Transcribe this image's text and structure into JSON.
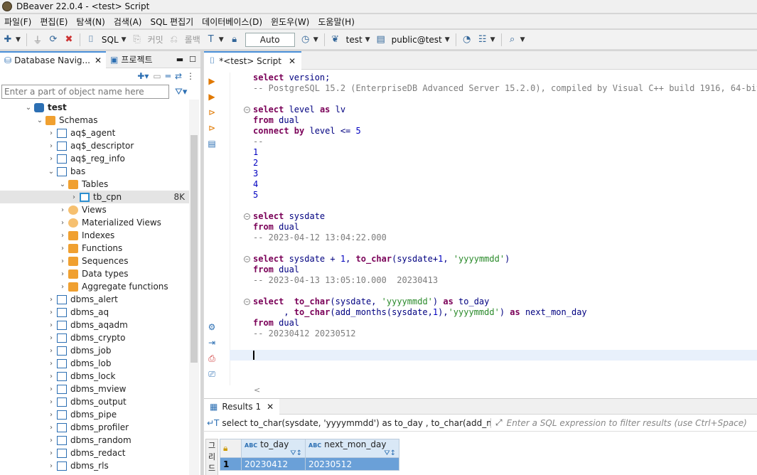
{
  "window": {
    "title": "DBeaver 22.0.4 - <test> Script"
  },
  "menubar": {
    "items": [
      "파일(F)",
      "편집(E)",
      "탐색(N)",
      "검색(A)",
      "SQL 편집기",
      "데이터베이스(D)",
      "윈도우(W)",
      "도움말(H)"
    ]
  },
  "toolbar": {
    "sql_label": "SQL",
    "commit_label": "커밋",
    "rollback_label": "롤백",
    "transaction_mode": "Auto",
    "connection": "test",
    "schema": "public@test"
  },
  "navigator": {
    "tab_label": "Database Navig...",
    "project_tab_label": "프로젝트",
    "filter_placeholder": "Enter a part of object name here",
    "tree": [
      {
        "label": "test",
        "level": 0,
        "arrow": "v",
        "icon": "db",
        "bold": true
      },
      {
        "label": "Schemas",
        "level": 1,
        "arrow": "v",
        "icon": "folder"
      },
      {
        "label": "aq$_agent",
        "level": 2,
        "arrow": ">",
        "icon": "schema"
      },
      {
        "label": "aq$_descriptor",
        "level": 2,
        "arrow": ">",
        "icon": "schema"
      },
      {
        "label": "aq$_reg_info",
        "level": 2,
        "arrow": ">",
        "icon": "schema"
      },
      {
        "label": "bas",
        "level": 2,
        "arrow": "v",
        "icon": "schema"
      },
      {
        "label": "Tables",
        "level": 3,
        "arrow": "v",
        "icon": "folder"
      },
      {
        "label": "tb_cpn",
        "level": 4,
        "arrow": ">",
        "icon": "table",
        "extra": "8K",
        "selected": true
      },
      {
        "label": "Views",
        "level": 3,
        "arrow": ">",
        "icon": "view"
      },
      {
        "label": "Materialized Views",
        "level": 3,
        "arrow": ">",
        "icon": "view"
      },
      {
        "label": "Indexes",
        "level": 3,
        "arrow": ">",
        "icon": "folder"
      },
      {
        "label": "Functions",
        "level": 3,
        "arrow": ">",
        "icon": "folder"
      },
      {
        "label": "Sequences",
        "level": 3,
        "arrow": ">",
        "icon": "folder"
      },
      {
        "label": "Data types",
        "level": 3,
        "arrow": ">",
        "icon": "folder"
      },
      {
        "label": "Aggregate functions",
        "level": 3,
        "arrow": ">",
        "icon": "folder"
      },
      {
        "label": "dbms_alert",
        "level": 2,
        "arrow": ">",
        "icon": "schema"
      },
      {
        "label": "dbms_aq",
        "level": 2,
        "arrow": ">",
        "icon": "schema"
      },
      {
        "label": "dbms_aqadm",
        "level": 2,
        "arrow": ">",
        "icon": "schema"
      },
      {
        "label": "dbms_crypto",
        "level": 2,
        "arrow": ">",
        "icon": "schema"
      },
      {
        "label": "dbms_job",
        "level": 2,
        "arrow": ">",
        "icon": "schema"
      },
      {
        "label": "dbms_lob",
        "level": 2,
        "arrow": ">",
        "icon": "schema"
      },
      {
        "label": "dbms_lock",
        "level": 2,
        "arrow": ">",
        "icon": "schema"
      },
      {
        "label": "dbms_mview",
        "level": 2,
        "arrow": ">",
        "icon": "schema"
      },
      {
        "label": "dbms_output",
        "level": 2,
        "arrow": ">",
        "icon": "schema"
      },
      {
        "label": "dbms_pipe",
        "level": 2,
        "arrow": ">",
        "icon": "schema"
      },
      {
        "label": "dbms_profiler",
        "level": 2,
        "arrow": ">",
        "icon": "schema"
      },
      {
        "label": "dbms_random",
        "level": 2,
        "arrow": ">",
        "icon": "schema"
      },
      {
        "label": "dbms_redact",
        "level": 2,
        "arrow": ">",
        "icon": "schema"
      },
      {
        "label": "dbms_rls",
        "level": 2,
        "arrow": ">",
        "icon": "schema"
      }
    ]
  },
  "editor": {
    "tab_label": "*<test> Script",
    "lines": [
      {
        "fold": false,
        "tokens": [
          [
            "kw",
            "select"
          ],
          [
            "fn",
            " version;"
          ]
        ]
      },
      {
        "fold": false,
        "tokens": [
          [
            "cmt",
            "-- PostgreSQL 15.2 (EnterpriseDB Advanced Server 15.2.0), compiled by Visual C++ build 1916, 64-bit"
          ]
        ]
      },
      {
        "fold": false,
        "tokens": []
      },
      {
        "fold": true,
        "tokens": [
          [
            "kw",
            "select"
          ],
          [
            "fn",
            " level "
          ],
          [
            "kw",
            "as"
          ],
          [
            "fn",
            " lv"
          ]
        ]
      },
      {
        "fold": false,
        "tokens": [
          [
            "kw",
            "from"
          ],
          [
            "fn",
            " dual"
          ]
        ]
      },
      {
        "fold": false,
        "tokens": [
          [
            "kw",
            "connect by"
          ],
          [
            "fn",
            " level <= "
          ],
          [
            "num",
            "5"
          ]
        ]
      },
      {
        "fold": false,
        "tokens": [
          [
            "cmt",
            "--"
          ]
        ]
      },
      {
        "fold": false,
        "tokens": [
          [
            "num",
            "1"
          ]
        ]
      },
      {
        "fold": false,
        "tokens": [
          [
            "num",
            "2"
          ]
        ]
      },
      {
        "fold": false,
        "tokens": [
          [
            "num",
            "3"
          ]
        ]
      },
      {
        "fold": false,
        "tokens": [
          [
            "num",
            "4"
          ]
        ]
      },
      {
        "fold": false,
        "tokens": [
          [
            "num",
            "5"
          ]
        ]
      },
      {
        "fold": false,
        "tokens": []
      },
      {
        "fold": true,
        "tokens": [
          [
            "kw",
            "select"
          ],
          [
            "fn",
            " sysdate"
          ]
        ]
      },
      {
        "fold": false,
        "tokens": [
          [
            "kw",
            "from"
          ],
          [
            "fn",
            " dual"
          ]
        ]
      },
      {
        "fold": false,
        "tokens": [
          [
            "cmt",
            "-- 2023-04-12 13:04:22.000"
          ]
        ]
      },
      {
        "fold": false,
        "tokens": []
      },
      {
        "fold": true,
        "tokens": [
          [
            "kw",
            "select"
          ],
          [
            "fn",
            " sysdate + "
          ],
          [
            "num",
            "1"
          ],
          [
            "fn",
            ", "
          ],
          [
            "kw",
            "to_char"
          ],
          [
            "fn",
            "(sysdate+"
          ],
          [
            "num",
            "1"
          ],
          [
            "fn",
            ", "
          ],
          [
            "str",
            "'yyyymmdd'"
          ],
          [
            "fn",
            ")"
          ]
        ]
      },
      {
        "fold": false,
        "tokens": [
          [
            "kw",
            "from"
          ],
          [
            "fn",
            " dual"
          ]
        ]
      },
      {
        "fold": false,
        "tokens": [
          [
            "cmt",
            "-- 2023-04-13 13:05:10.000  20230413"
          ]
        ]
      },
      {
        "fold": false,
        "tokens": []
      },
      {
        "fold": true,
        "tokens": [
          [
            "kw",
            "select"
          ],
          [
            "fn",
            "  "
          ],
          [
            "kw",
            "to_char"
          ],
          [
            "fn",
            "(sysdate, "
          ],
          [
            "str",
            "'yyyymmdd'"
          ],
          [
            "fn",
            ") "
          ],
          [
            "kw",
            "as"
          ],
          [
            "fn",
            " to_day"
          ]
        ]
      },
      {
        "fold": false,
        "tokens": [
          [
            "fn",
            "      , "
          ],
          [
            "kw",
            "to_char"
          ],
          [
            "fn",
            "(add_months(sysdate,"
          ],
          [
            "num",
            "1"
          ],
          [
            "fn",
            "),"
          ],
          [
            "str",
            "'yyyymmdd'"
          ],
          [
            "fn",
            ") "
          ],
          [
            "kw",
            "as"
          ],
          [
            "fn",
            " next_mon_day"
          ]
        ]
      },
      {
        "fold": false,
        "tokens": [
          [
            "kw",
            "from"
          ],
          [
            "fn",
            " dual"
          ]
        ]
      },
      {
        "fold": false,
        "tokens": [
          [
            "cmt",
            "-- 20230412 20230512"
          ]
        ]
      },
      {
        "fold": false,
        "tokens": []
      },
      {
        "fold": false,
        "tokens": [],
        "cursor": true
      }
    ]
  },
  "results": {
    "tab_label": "Results 1",
    "query_text": "select to_char(sysdate, 'yyyymmdd') as to_day , to_char(add_months(sy",
    "filter_placeholder": "Enter a SQL expression to filter results (use Ctrl+Space)",
    "side_label": "그리드",
    "columns": [
      "to_day",
      "next_mon_day"
    ],
    "rows": [
      {
        "num": "1",
        "cells": [
          "20230412",
          "20230512"
        ]
      }
    ]
  }
}
